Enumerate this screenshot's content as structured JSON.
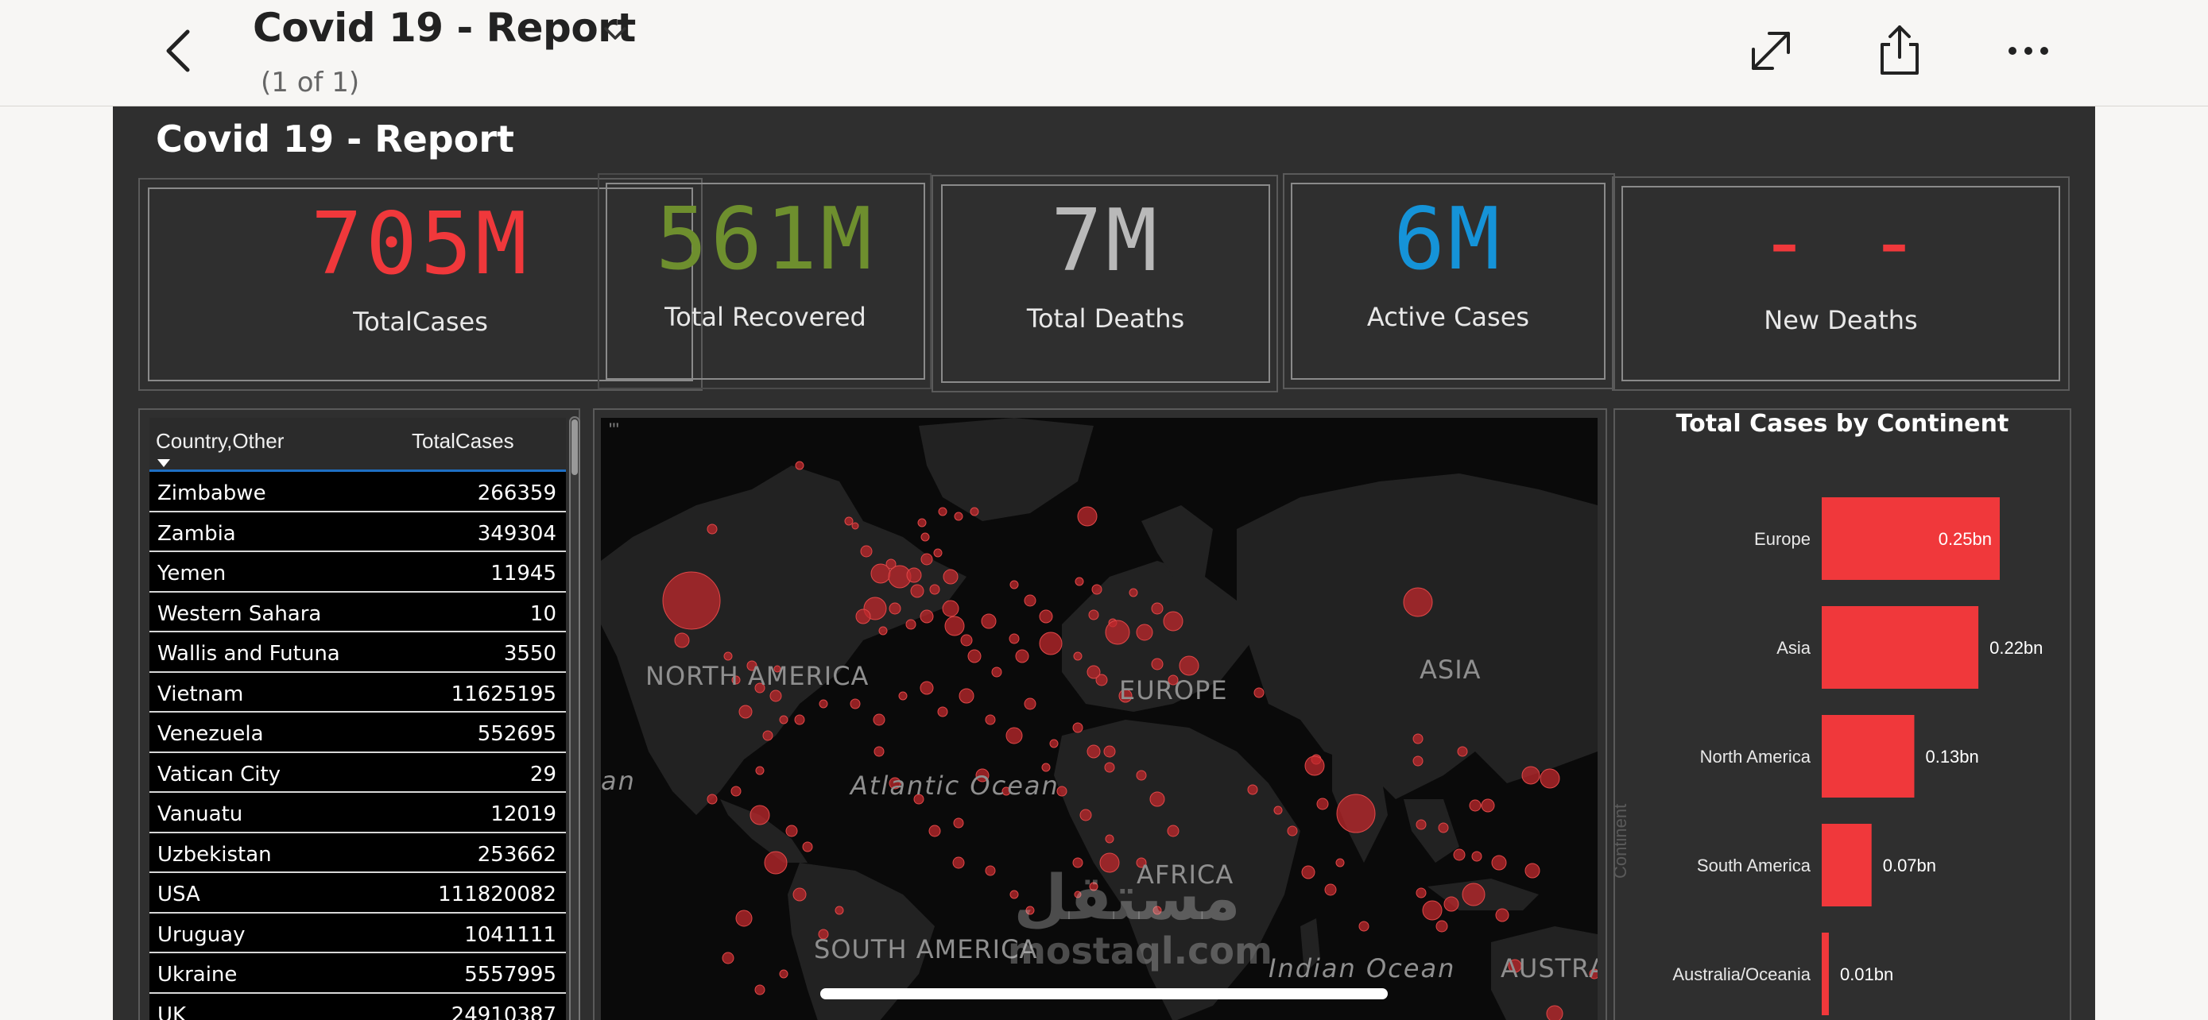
{
  "header": {
    "title": "Covid 19 - Report",
    "page_indicator": "(1 of 1)",
    "icons": [
      "back-chevron-icon",
      "chevron-down-icon",
      "expand-icon",
      "share-icon",
      "more-icon"
    ]
  },
  "report": {
    "title": "Covid 19 - Report",
    "kpis": [
      {
        "value": "705M",
        "label": "TotalCases",
        "color": "#f0383b"
      },
      {
        "value": "561M",
        "label": "Total Recovered",
        "color": "#6e8f2e"
      },
      {
        "value": "7M",
        "label": "Total Deaths",
        "color": "#b9b9b9"
      },
      {
        "value": "6M",
        "label": "Active Cases",
        "color": "#1593d8"
      },
      {
        "value": "- -",
        "label": "New Deaths",
        "color": "#f0383b"
      }
    ]
  },
  "table": {
    "columns": [
      "Country,Other",
      "TotalCases"
    ],
    "rows": [
      [
        "Zimbabwe",
        "266359"
      ],
      [
        "Zambia",
        "349304"
      ],
      [
        "Yemen",
        "11945"
      ],
      [
        "Western Sahara",
        "10"
      ],
      [
        "Wallis and Futuna",
        "3550"
      ],
      [
        "Vietnam",
        "11625195"
      ],
      [
        "Venezuela",
        "552695"
      ],
      [
        "Vatican City",
        "29"
      ],
      [
        "Vanuatu",
        "12019"
      ],
      [
        "Uzbekistan",
        "253662"
      ],
      [
        "USA",
        "111820082"
      ],
      [
        "Uruguay",
        "1041111"
      ],
      [
        "Ukraine",
        "5557995"
      ],
      [
        "UK",
        "24910387"
      ]
    ]
  },
  "map": {
    "corner_mark": "\"'",
    "continent_labels": [
      "NORTH AMERICA",
      "EUROPE",
      "ASIA",
      "AFRICA",
      "SOUTH AMERICA",
      "AUSTRA"
    ],
    "ocean_labels": [
      "Atlantic Ocean",
      "Indian Ocean",
      "an"
    ],
    "bubble_color": "#c0282c"
  },
  "chart_data": {
    "type": "bar",
    "title": "Total Cases by Continent",
    "ylabel": "Continent",
    "categories": [
      "Europe",
      "Asia",
      "North America",
      "South America",
      "Australia/Oceania"
    ],
    "values": [
      0.25,
      0.22,
      0.13,
      0.07,
      0.01
    ],
    "data_labels": [
      "0.25bn",
      "0.22bn",
      "0.13bn",
      "0.07bn",
      "0.01bn"
    ],
    "unit": "bn",
    "bar_color": "#f0383b",
    "xlim": [
      0,
      0.25
    ]
  },
  "watermark": {
    "arabic": "مستقل",
    "latin": "mostaql.com"
  }
}
